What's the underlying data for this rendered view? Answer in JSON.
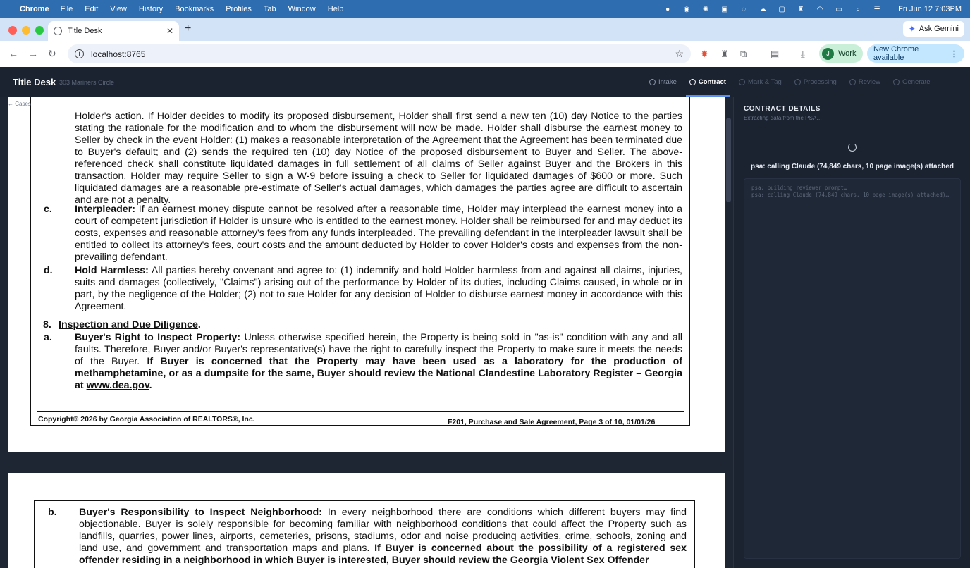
{
  "menubar": {
    "app": "Chrome",
    "items": [
      "File",
      "Edit",
      "View",
      "History",
      "Bookmarks",
      "Profiles",
      "Tab",
      "Window",
      "Help"
    ],
    "clock": "Fri Jun 12  7:03PM"
  },
  "browser": {
    "tab_title": "Title Desk",
    "url": "localhost:8765",
    "ask_gemini": "Ask Gemini",
    "profile_initial": "J",
    "profile_label": "Work",
    "update_label": "New Chrome available"
  },
  "app": {
    "title": "Title Desk",
    "subtitle": "303 Mariners Circle",
    "back_link": "← Cases",
    "steps": [
      {
        "label": "Intake",
        "state": "done"
      },
      {
        "label": "Contract",
        "state": "active"
      },
      {
        "label": "Mark & Tag",
        "state": "pending"
      },
      {
        "label": "Processing",
        "state": "pending"
      },
      {
        "label": "Review",
        "state": "pending"
      },
      {
        "label": "Generate",
        "state": "pending"
      }
    ]
  },
  "document": {
    "p_top": "Holder's action. If Holder decides to modify its proposed disbursement, Holder shall first send a new ten (10) day Notice to the parties stating the rationale for the modification and to whom the disbursement will now be made. Holder shall disburse the earnest money to Seller by check in the event Holder: (1) makes a reasonable interpretation of the Agreement that the Agreement has been terminated due to Buyer's default; and (2) sends the required ten (10) day Notice of the proposed disbursement to Buyer and Seller. The above-referenced check shall constitute liquidated damages in full settlement of all claims of Seller against Buyer and the Brokers in this transaction. Holder may require Seller to sign a W-9 before issuing a check to Seller for liquidated damages of $600 or more. Such liquidated damages are a reasonable pre-estimate of Seller's actual damages, which damages the parties agree are difficult to ascertain and are not a penalty.",
    "c_label": "c.",
    "c_title": "Interpleader:",
    "c_text": "If an earnest money dispute cannot be resolved after a reasonable time, Holder may interplead the earnest money into a court of competent jurisdiction if Holder is unsure who is entitled to the earnest money. Holder shall be reimbursed for and may deduct its costs, expenses and reasonable attorney's fees from any funds interpleaded. The prevailing defendant in the interpleader lawsuit shall be entitled to collect its attorney's fees, court costs and the amount deducted by Holder to cover Holder's costs and expenses from the non-prevailing defendant.",
    "d_label": "d.",
    "d_title": "Hold Harmless:",
    "d_text": "All parties hereby covenant and agree to: (1) indemnify and hold Holder harmless from and against all claims, injuries, suits and damages (collectively, \"Claims\") arising out of the performance by Holder of its duties, including Claims caused, in whole or in part, by the negligence of the Holder; (2) not to sue Holder for any decision of Holder to disburse earnest money in accordance with this Agreement.",
    "s8_num": "8.",
    "s8_title": "Inspection and Due Diligence",
    "s8_dot": ".",
    "a_label": "a.",
    "a_title": "Buyer's Right to Inspect Property:",
    "a_text": "Unless otherwise specified herein, the Property is being sold in \"as-is\" condition with any and all faults. Therefore, Buyer and/or Buyer's representative(s) have the right to carefully inspect the Property to make sure it meets the needs of the Buyer.",
    "a_bold": "If Buyer is concerned that the Property may have been used as a laboratory for the production of methamphetamine, or as a dumpsite for the same, Buyer should review the National Clandestine Laboratory Register – Georgia at",
    "a_link": "www.dea.gov",
    "a_end": ".",
    "footer_left": "Copyright© 2026 by Georgia Association of REALTORS®, Inc.",
    "footer_right": "F201, Purchase and Sale Agreement, Page 3 of 10, 01/01/26",
    "b_label": "b.",
    "b_title": "Buyer's Responsibility to Inspect Neighborhood:",
    "b_text": "In every neighborhood there are conditions which different buyers may find objectionable. Buyer is solely responsible for becoming familiar with neighborhood conditions that could affect the Property such as landfills, quarries, power lines, airports, cemeteries, prisons, stadiums, odor and noise producing activities, crime, schools, zoning and land use, and government and transportation maps and plans.",
    "b_bold": "If Buyer is concerned about the possibility of a registered sex offender residing in a neighborhood in which Buyer is interested, Buyer should review the Georgia Violent Sex Offender"
  },
  "panel": {
    "title": "CONTRACT DETAILS",
    "subtitle": "Extracting data from the PSA…",
    "status": "psa: calling Claude (74,849 chars, 10 page image(s) attached",
    "log": [
      "psa: building reviewer prompt…",
      "psa: calling Claude (74,849 chars, 10 page image(s) attached)…"
    ]
  }
}
